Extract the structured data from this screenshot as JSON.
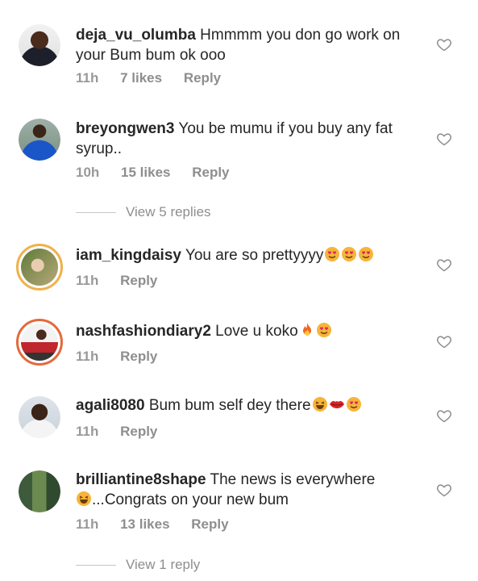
{
  "comments": [
    {
      "user": "deja_vu_olumba",
      "text": "Hmmmm you don go work on your Bum bum ok ooo",
      "time": "11h",
      "likes": "7 likes",
      "reply": "Reply"
    },
    {
      "user": "breyongwen3",
      "text": "You be mumu if you buy any fat syrup..",
      "time": "10h",
      "likes": "15 likes",
      "reply": "Reply",
      "view_replies": "View 5 replies"
    },
    {
      "user": "iam_kingdaisy",
      "text": "You are so prettyyyy",
      "time": "11h",
      "reply": "Reply",
      "emojis": [
        "heart-eyes-emoji",
        "heart-eyes-emoji",
        "heart-eyes-emoji"
      ]
    },
    {
      "user": "nashfashiondiary2",
      "text": "Love u koko",
      "time": "11h",
      "reply": "Reply",
      "emojis": [
        "fire-emoji",
        "heart-eyes-emoji"
      ]
    },
    {
      "user": "agali8080",
      "text": "Bum bum self dey there",
      "time": "11h",
      "reply": "Reply",
      "emojis": [
        "laughing-emoji",
        "kiss-lips-emoji",
        "heart-eyes-emoji"
      ]
    },
    {
      "user": "brilliantine8shape",
      "text": "The news is everywhere",
      "text2": "...Congrats on your new bum",
      "time": "11h",
      "likes": "13 likes",
      "reply": "Reply",
      "view_replies": "View 1 reply",
      "emojis": [
        "laughing-emoji"
      ]
    }
  ],
  "icons": {
    "like": "heart-outline-icon"
  },
  "colors": {
    "username": "#262626",
    "meta": "#8e8e8e",
    "story_ring": "#f0b14a"
  }
}
